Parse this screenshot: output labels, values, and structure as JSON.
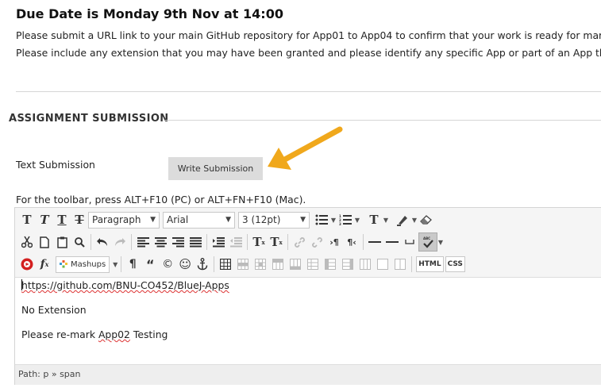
{
  "header": {
    "due_title": "Due Date is Monday 9th Nov at 14:00",
    "instruction_1": "Please submit a URL link to your main GitHub repository for App01 to App04 to confirm that your work is ready for markin",
    "instruction_2": "Please include any extension that you may have been granted and please identify any specific App or part of an App that y"
  },
  "section": {
    "heading": "ASSIGNMENT SUBMISSION"
  },
  "submission": {
    "text_label": "Text Submission",
    "write_button": "Write Submission",
    "toolbar_hint": "For the toolbar, press ALT+F10 (PC) or ALT+FN+F10 (Mac)."
  },
  "toolbar": {
    "format_value": "Paragraph",
    "font_value": "Arial",
    "size_value": "3 (12pt)",
    "mashups_label": "Mashups",
    "html_label": "HTML",
    "css_label": "CSS",
    "accent_color": "#f0a81c"
  },
  "content": {
    "line1_prefix": "https://github.com/BNU-CO452/",
    "line1_mid": "BlueJ-Apps",
    "line2": "No Extension",
    "line3_a": "Please re-mark ",
    "line3_b": "App02",
    "line3_c": " Testing"
  },
  "pathbar": {
    "text": "Path: p » span"
  }
}
